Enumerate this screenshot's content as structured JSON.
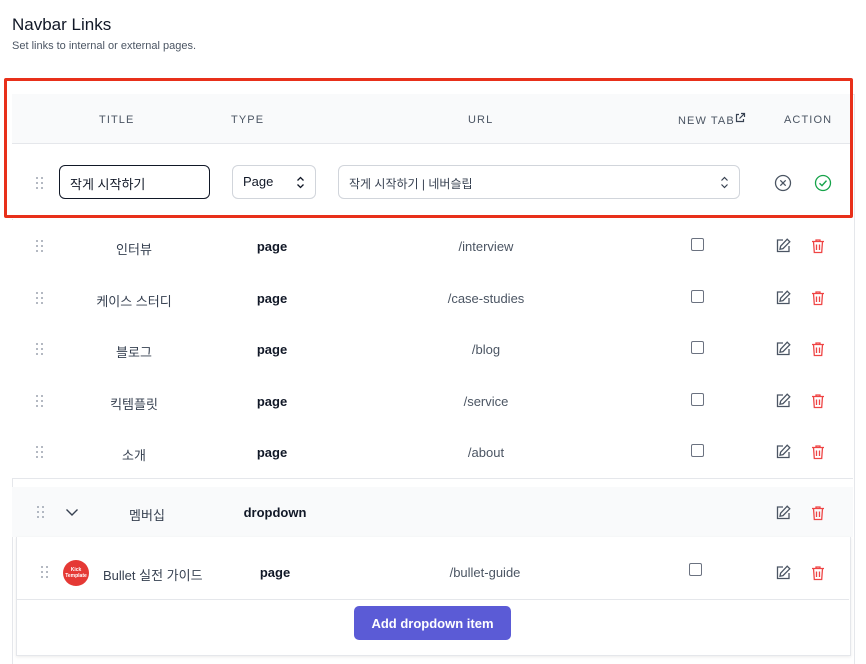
{
  "page": {
    "title": "Navbar Links",
    "subtitle": "Set links to internal or external pages."
  },
  "table": {
    "headers": {
      "title": "TITLE",
      "type": "TYPE",
      "url": "URL",
      "new_tab": "NEW TAB",
      "action": "ACTION"
    },
    "new_tab_icon": "external-link-icon"
  },
  "edit_row": {
    "title_value": "작게 시작하기",
    "type_value": "Page",
    "url_value": "작게 시작하기 | 네버슬립"
  },
  "rows": [
    {
      "title": "인터뷰",
      "type": "page",
      "url": "/interview",
      "new_tab": false
    },
    {
      "title": "케이스 스터디",
      "type": "page",
      "url": "/case-studies",
      "new_tab": false
    },
    {
      "title": "블로그",
      "type": "page",
      "url": "/blog",
      "new_tab": false
    },
    {
      "title": "킥템플릿",
      "type": "page",
      "url": "/service",
      "new_tab": false
    },
    {
      "title": "소개",
      "type": "page",
      "url": "/about",
      "new_tab": false
    }
  ],
  "dropdown": {
    "title": "멤버십",
    "type": "dropdown",
    "children": [
      {
        "avatar_text": "Kick Template",
        "title": "Bullet 실전 가이드",
        "type": "page",
        "url": "/bullet-guide",
        "new_tab": false
      }
    ],
    "add_label": "Add dropdown item"
  },
  "colors": {
    "accent": "#5b5bd6",
    "highlight": "#e8301a",
    "delete": "#ef4444",
    "confirm": "#16a34a"
  }
}
